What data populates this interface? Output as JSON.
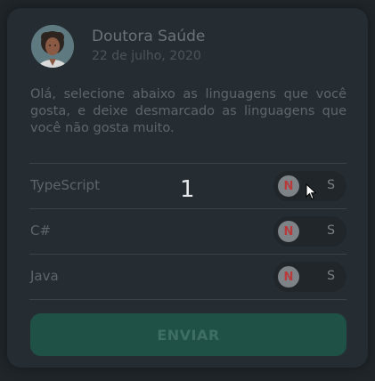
{
  "profile": {
    "name": "Doutora Saúde",
    "date": "22 de julho, 2020"
  },
  "intro_text": "Olá, selecione abaixo as linguagens que você gosta, e deixe desmarcado as linguagens que você não gosta muito.",
  "languages": [
    {
      "label": "TypeScript",
      "off_label": "N",
      "on_label": "S",
      "selected": false
    },
    {
      "label": "C#",
      "off_label": "N",
      "on_label": "S",
      "selected": false
    },
    {
      "label": "Java",
      "off_label": "N",
      "on_label": "S",
      "selected": false
    }
  ],
  "counter": "1",
  "submit_label": "ENVIAR",
  "colors": {
    "card": "#262d32",
    "button": "#1f5147",
    "knob_letter": "#b83a3a"
  },
  "icons": {
    "avatar": "doctor-avatar-icon",
    "cursor": "mouse-pointer-icon"
  }
}
